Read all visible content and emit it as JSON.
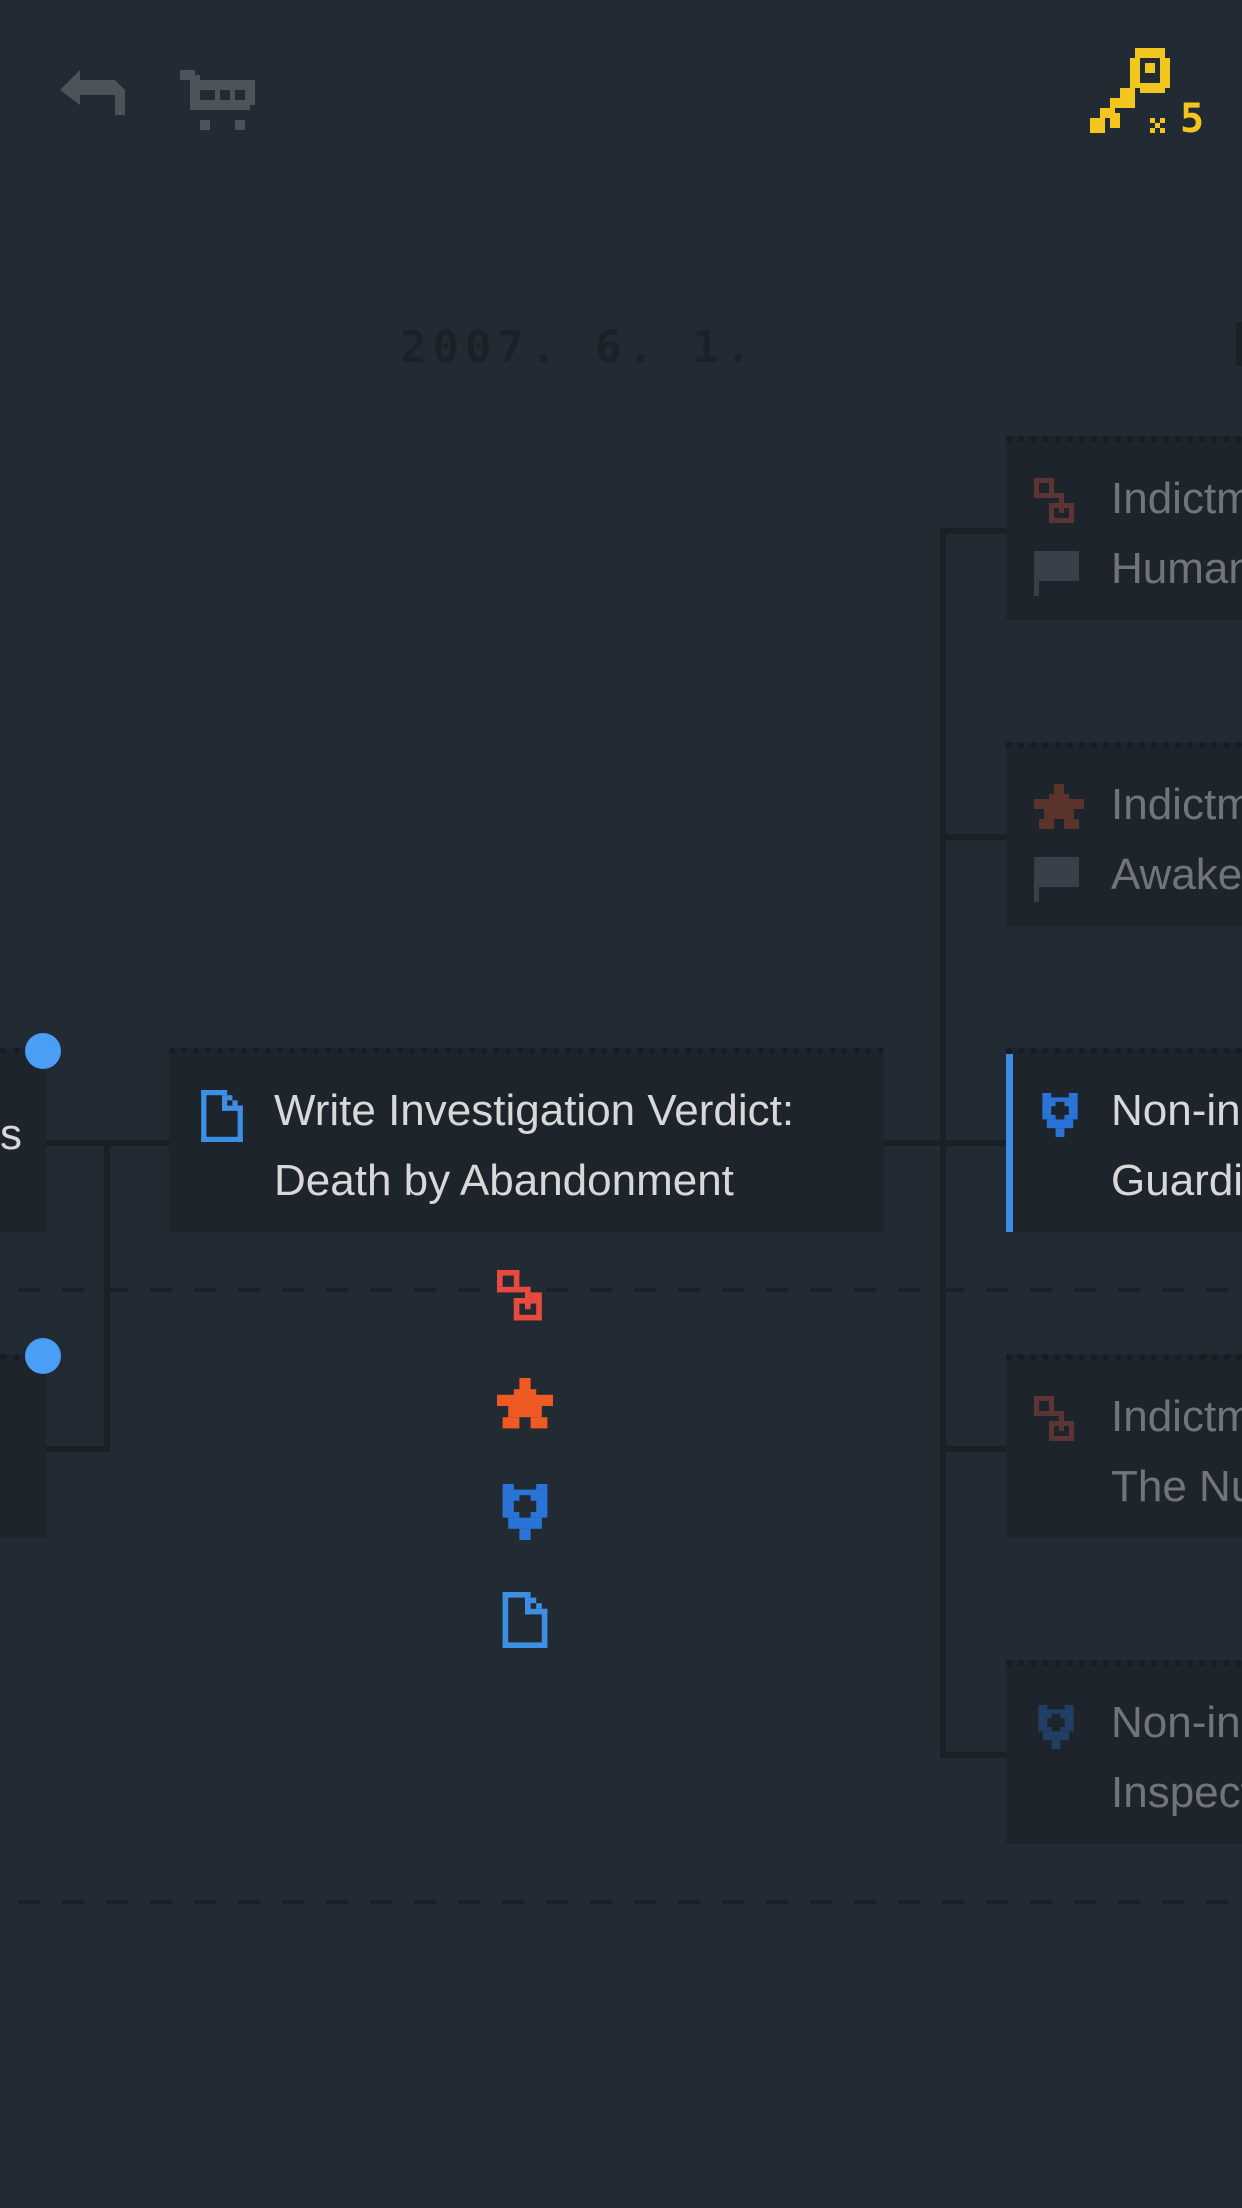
{
  "header": {
    "back_icon": "back-arrow-icon",
    "shop_icon": "shopping-cart-icon",
    "key_icon": "key-icon",
    "key_count": "5",
    "key_color": "#f3c51f"
  },
  "timeline": {
    "date": "2007. 6. 1."
  },
  "left_partial": {
    "text": "s"
  },
  "main_card": {
    "icon": "document-icon",
    "line1": "Write Investigation Verdict:",
    "line2": "Death by Abandonment"
  },
  "branches": [
    {
      "icon": "chain-link-icon",
      "line1": "Indictm",
      "line2": "Human",
      "icon2": "flag-icon"
    },
    {
      "icon": "star-icon",
      "line1": "Indictm",
      "line2": "Awaken",
      "icon2": "flag-icon"
    },
    {
      "icon": "shield-icon",
      "line1": "Non-ind",
      "line2": "Guardia"
    },
    {
      "icon": "chain-link-icon",
      "line1": "Indictm",
      "line2": "The Nur"
    },
    {
      "icon": "shield-icon",
      "line1": "Non-ind",
      "line2": "Inspect"
    }
  ],
  "legend": [
    {
      "icon": "chain-link-icon",
      "color": "#e84a3f"
    },
    {
      "icon": "star-icon",
      "color": "#ef5a24"
    },
    {
      "icon": "shield-icon",
      "color": "#2a74d8"
    },
    {
      "icon": "document-icon",
      "color": "#3d8fe6"
    }
  ],
  "colors": {
    "background": "#222a33",
    "card": "#1d242c",
    "accent_blue": "#3d8fe6",
    "node_dot": "#4a9ef5"
  }
}
